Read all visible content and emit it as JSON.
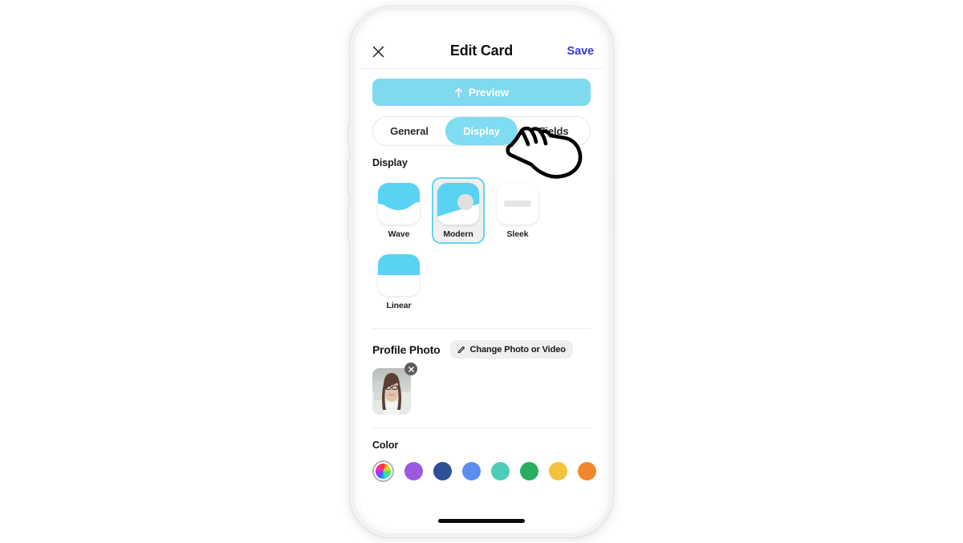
{
  "navbar": {
    "close_icon": "close-icon",
    "title": "Edit Card",
    "save_label": "Save",
    "save_color": "#3a3ad6"
  },
  "preview": {
    "label": "Preview",
    "icon": "up-arrow-icon",
    "background": "#7fd9ef"
  },
  "tabs": [
    {
      "label": "General",
      "active": false
    },
    {
      "label": "Display",
      "active": true
    },
    {
      "label": "Fields",
      "active": false
    }
  ],
  "tab_active_color": "#7fdcf2",
  "display_section": {
    "label": "Display",
    "styles": [
      {
        "name": "Wave",
        "selected": false,
        "thumb": "wave"
      },
      {
        "name": "Modern",
        "selected": true,
        "thumb": "modern"
      },
      {
        "name": "Sleek",
        "selected": false,
        "thumb": "sleek"
      },
      {
        "name": "Linear",
        "selected": false,
        "thumb": "linear"
      }
    ],
    "accent": "#5ad2f4"
  },
  "profile_photo": {
    "title": "Profile Photo",
    "change_button_label": "Change Photo or Video",
    "change_button_icon": "pencil-icon",
    "remove_icon": "close-icon",
    "photo_alt": "woman-with-glasses-portrait"
  },
  "color_section": {
    "label": "Color",
    "picker_name": "color-wheel-picker",
    "picker_selected": true,
    "swatches": [
      {
        "name": "purple",
        "hex": "#9b59e0"
      },
      {
        "name": "navy",
        "hex": "#2f4f96"
      },
      {
        "name": "blue",
        "hex": "#5b8def"
      },
      {
        "name": "teal",
        "hex": "#4dccb8"
      },
      {
        "name": "green",
        "hex": "#27ae60"
      },
      {
        "name": "yellow",
        "hex": "#f5c33b"
      },
      {
        "name": "orange",
        "hex": "#f2872e"
      }
    ]
  },
  "overlay": {
    "cursor": "pointing-hand-cursor"
  }
}
